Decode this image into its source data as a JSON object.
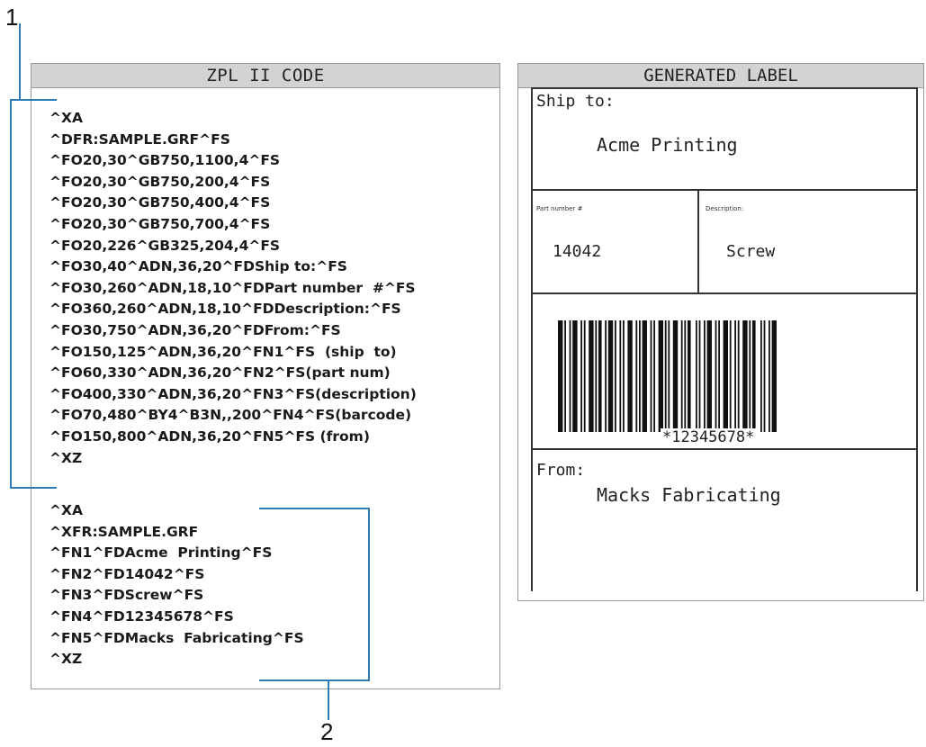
{
  "callouts": {
    "one": "1",
    "two": "2"
  },
  "code_panel": {
    "title": "ZPL II CODE",
    "lines": [
      "^XA",
      "^DFR:SAMPLE.GRF^FS",
      "^FO20,30^GB750,1100,4^FS",
      "^FO20,30^GB750,200,4^FS",
      "^FO20,30^GB750,400,4^FS",
      "^FO20,30^GB750,700,4^FS",
      "^FO20,226^GB325,204,4^FS",
      "^FO30,40^ADN,36,20^FDShip to:^FS",
      "^FO30,260^ADN,18,10^FDPart number  #^FS",
      "^FO360,260^ADN,18,10^FDDescription:^FS",
      "^FO30,750^ADN,36,20^FDFrom:^FS",
      "^FO150,125^ADN,36,20^FN1^FS  (ship  to)",
      "^FO60,330^ADN,36,20^FN2^FS(part num)",
      "^FO400,330^ADN,36,20^FN3^FS(description)",
      "^FO70,480^BY4^B3N,,200^FN4^FS(barcode)",
      "^FO150,800^ADN,36,20^FN5^FS (from)",
      "^XZ",
      "^XA",
      "^XFR:SAMPLE.GRF",
      "^FN1^FDAcme  Printing^FS",
      "^FN2^FD14042^FS",
      "^FN3^FDScrew^FS",
      "^FN4^FD12345678^FS",
      "^FN5^FDMacks  Fabricating^FS",
      "^XZ"
    ]
  },
  "label_panel": {
    "title": "GENERATED LABEL",
    "ship_to_label": "Ship to:",
    "ship_to_value": "Acme Printing",
    "part_number_label": "Part number #",
    "description_label": "Description:",
    "part_number_value": "14042",
    "description_value": "Screw",
    "barcode_text": "*12345678*",
    "from_label": "From:",
    "from_value": "Macks Fabricating"
  },
  "colors": {
    "bracket": "#2e7bb5",
    "header_bg": "#d3d3d3",
    "border": "#9a9a9a"
  }
}
